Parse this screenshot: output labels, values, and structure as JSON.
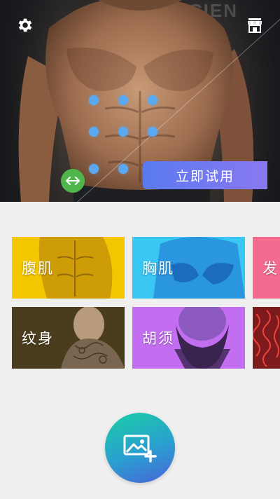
{
  "hero": {
    "gym_sign_text": "SCIEN",
    "try_button_label": "立即试用",
    "settings_icon": "gear-icon",
    "store_icon": "store-icon",
    "swap_icon": "swap-arrows-icon",
    "dot_color": "#5aa9f0"
  },
  "categories": {
    "items": [
      {
        "label": "腹肌",
        "color": "#f3c600"
      },
      {
        "label": "胸肌",
        "color": "#39c6f2"
      },
      {
        "label": "发",
        "color": "#f56b8f"
      },
      {
        "label": "纹身",
        "color": "#4a3d1d"
      },
      {
        "label": "胡须",
        "color": "#c36ef0"
      },
      {
        "label": "",
        "color": "#7d1a1d"
      }
    ]
  },
  "fab": {
    "icon": "add-photo-icon"
  }
}
